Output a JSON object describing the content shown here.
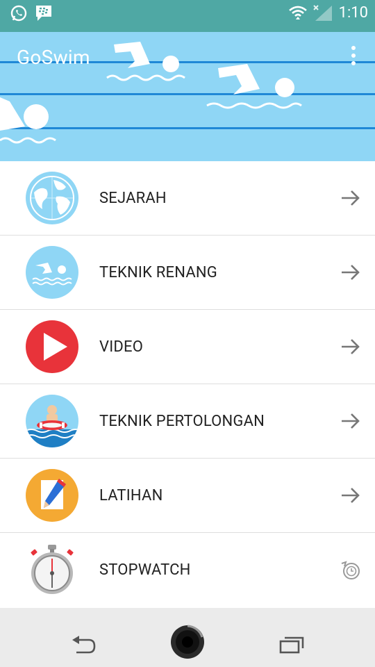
{
  "status_bar": {
    "time": "1:10",
    "icons": [
      "whatsapp-icon",
      "bbm-icon",
      "wifi-icon",
      "signal-icon"
    ]
  },
  "header": {
    "title": "GoSwim",
    "menu_icon": "overflow-menu-icon"
  },
  "menu": [
    {
      "label": "SEJARAH",
      "icon": "globe-icon",
      "action_icon": "arrow-right-icon"
    },
    {
      "label": "TEKNIK RENANG",
      "icon": "swimmer-icon",
      "action_icon": "arrow-right-icon"
    },
    {
      "label": "VIDEO",
      "icon": "play-icon",
      "action_icon": "arrow-right-icon"
    },
    {
      "label": "TEKNIK PERTOLONGAN",
      "icon": "lifebuoy-icon",
      "action_icon": "arrow-right-icon"
    },
    {
      "label": "LATIHAN",
      "icon": "notepad-icon",
      "action_icon": "arrow-right-icon"
    },
    {
      "label": "STOPWATCH",
      "icon": "stopwatch-icon",
      "action_icon": "history-icon"
    }
  ],
  "nav_bar": {
    "buttons": [
      "back-icon",
      "home-icon",
      "recents-icon"
    ]
  },
  "colors": {
    "status_bar": "#4fa8a4",
    "header_bg": "#8fd6f5",
    "lane": "#1f88d6",
    "video_red": "#e8333a",
    "notepad_orange": "#f4a933",
    "icon_blue": "#8fd6f5"
  }
}
